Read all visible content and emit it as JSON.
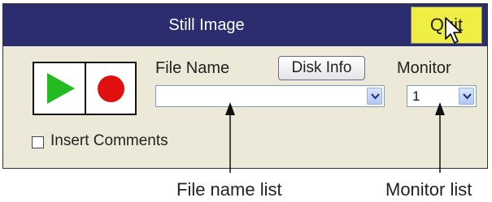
{
  "window": {
    "title": "Still Image",
    "quit_label": "Quit"
  },
  "controls": {
    "file_name_label": "File Name",
    "disk_info_label": "Disk Info",
    "file_name_value": "",
    "monitor_label": "Monitor",
    "monitor_value": "1",
    "insert_comments_label": "Insert Comments",
    "insert_comments_checked": false
  },
  "icons": {
    "play": "play-icon",
    "record": "record-icon",
    "dropdown": "chevron-down-icon",
    "cursor": "mouse-cursor-icon"
  },
  "colors": {
    "title_bar": "#2b2d6e",
    "quit_button": "#eeee44",
    "play": "#22bb22",
    "record": "#e01010",
    "panel": "#ece9d8"
  },
  "captions": {
    "file_name_list": "File name list",
    "monitor_list": "Monitor list"
  }
}
